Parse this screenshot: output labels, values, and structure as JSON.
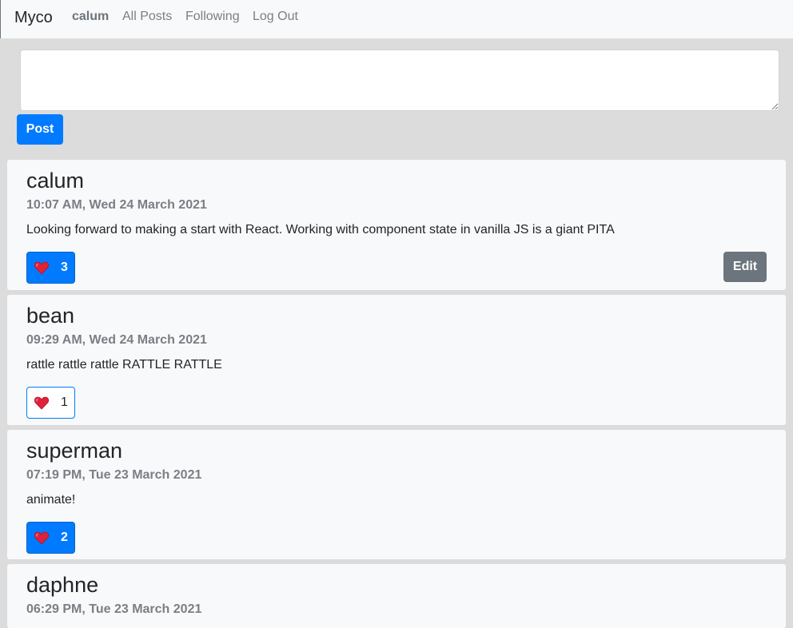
{
  "nav": {
    "brand": "Myco",
    "user": "calum",
    "all_posts": "All Posts",
    "following": "Following",
    "log_out": "Log Out"
  },
  "composer": {
    "value": "",
    "post_label": "Post"
  },
  "colors": {
    "primary": "#007bff",
    "secondary": "#6c757d",
    "card_bg": "#f8f9fa",
    "page_bg": "#dcdcdc"
  },
  "posts": [
    {
      "author": "calum",
      "timestamp": "10:07 AM, Wed 24 March 2021",
      "content": "Looking forward to making a start with React. Working with component state in vanilla JS is a giant PITA",
      "likes": "3",
      "liked": true,
      "edit_label": "Edit"
    },
    {
      "author": "bean",
      "timestamp": "09:29 AM, Wed 24 March 2021",
      "content": "rattle rattle rattle RATTLE RATTLE",
      "likes": "1",
      "liked": false
    },
    {
      "author": "superman",
      "timestamp": "07:19 PM, Tue 23 March 2021",
      "content": "animate!",
      "likes": "2",
      "liked": true
    },
    {
      "author": "daphne",
      "timestamp": "06:29 PM, Tue 23 March 2021"
    }
  ],
  "icons": {
    "like": "heart-icon",
    "resize": "resize-grip-icon"
  }
}
